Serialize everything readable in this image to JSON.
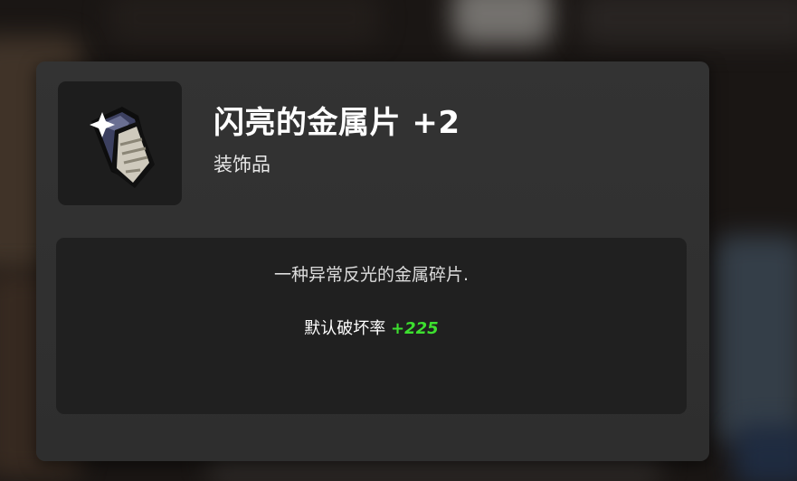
{
  "item": {
    "name": "闪亮的金属片 +2",
    "type": "装饰品",
    "icon": "shiny-metal-shard-icon",
    "description": "一种异常反光的金属碎片.",
    "stat": {
      "label": "默认破坏率",
      "value": "+225"
    }
  },
  "colors": {
    "card_bg": "#313131",
    "panel_bg": "#202020",
    "icon_bg": "#1d1d1d",
    "stat_value": "#3de02f"
  }
}
